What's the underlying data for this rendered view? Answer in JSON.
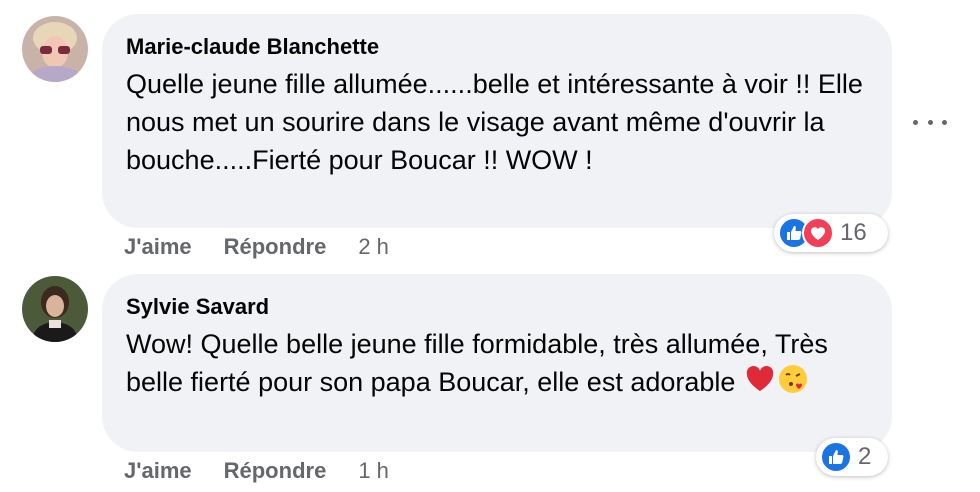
{
  "comments": [
    {
      "author": "Marie-claude Blanchette",
      "text": "Quelle jeune fille allumée......belle et intéressante à voir !! Elle nous met un sourire dans le visage avant même d'ouvrir la bouche.....Fierté pour Boucar !! WOW !",
      "reaction_count": "16",
      "reactions": [
        "like-icon",
        "love-icon"
      ],
      "like_label": "J'aime",
      "reply_label": "Répondre",
      "time": "2 h"
    },
    {
      "author": "Sylvie Savard",
      "text": "Wow! Quelle belle jeune fille formidable, très allumée, Très belle fierté pour son papa Boucar, elle est adorable",
      "emojis": [
        "red-heart-emoji",
        "face-blowing-kiss-emoji"
      ],
      "reaction_count": "2",
      "reactions": [
        "like-icon"
      ],
      "like_label": "J'aime",
      "reply_label": "Répondre",
      "time": "1 h"
    }
  ],
  "colors": {
    "bubble": "#f0f2f5",
    "meta_text": "#65676b",
    "like_blue": "#1b74e4",
    "love_red": "#f33e58"
  }
}
